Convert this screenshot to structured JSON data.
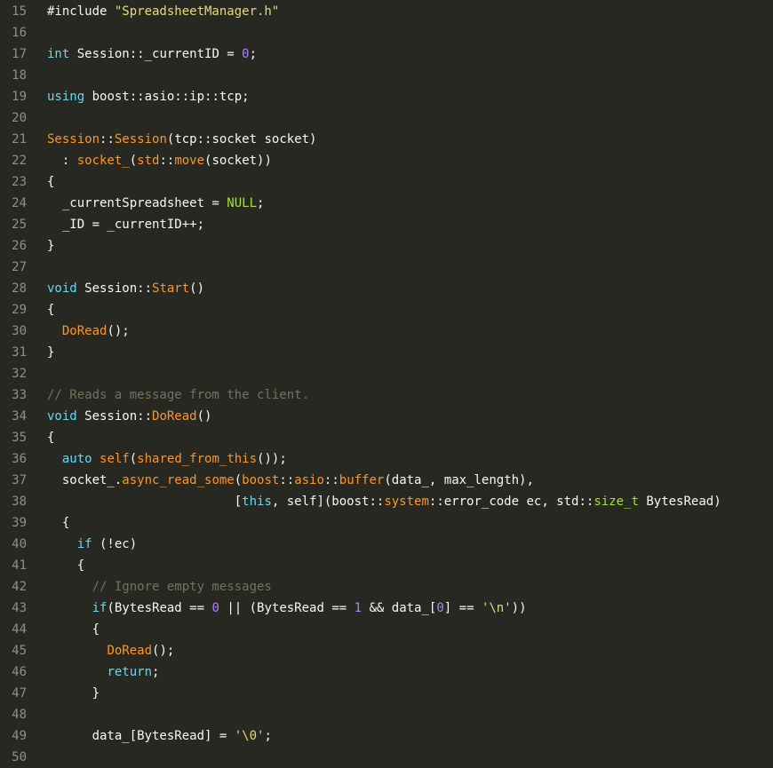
{
  "colors": {
    "background": "#272822",
    "gutter_text": "#8f908a",
    "default_text": "#f8f8f2",
    "keyword": "#66d9ef",
    "string": "#e6db74",
    "number": "#ae81ff",
    "function": "#fd971f",
    "namespace": "#f92672",
    "type": "#a6e22e",
    "comment": "#75715e",
    "literal": "#a6e22e"
  },
  "editor": {
    "lines": [
      {
        "num": "15",
        "tokens": [
          {
            "t": "#include ",
            "c": "default"
          },
          {
            "t": "\"SpreadsheetManager.h\"",
            "c": "string"
          }
        ]
      },
      {
        "num": "16",
        "tokens": []
      },
      {
        "num": "17",
        "tokens": [
          {
            "t": "int",
            "c": "keyword"
          },
          {
            "t": " Session::_currentID = ",
            "c": "default"
          },
          {
            "t": "0",
            "c": "number"
          },
          {
            "t": ";",
            "c": "default"
          }
        ]
      },
      {
        "num": "18",
        "tokens": []
      },
      {
        "num": "19",
        "tokens": [
          {
            "t": "using",
            "c": "keyword"
          },
          {
            "t": " boost::asio::ip::tcp;",
            "c": "default"
          }
        ]
      },
      {
        "num": "20",
        "tokens": []
      },
      {
        "num": "21",
        "tokens": [
          {
            "t": "Session",
            "c": "function"
          },
          {
            "t": "::",
            "c": "default"
          },
          {
            "t": "Session",
            "c": "function"
          },
          {
            "t": "(tcp::socket socket)",
            "c": "default"
          }
        ]
      },
      {
        "num": "22",
        "tokens": [
          {
            "t": "  : ",
            "c": "default"
          },
          {
            "t": "socket_",
            "c": "function"
          },
          {
            "t": "(",
            "c": "default"
          },
          {
            "t": "std",
            "c": "function"
          },
          {
            "t": "::",
            "c": "default"
          },
          {
            "t": "move",
            "c": "function"
          },
          {
            "t": "(socket))",
            "c": "default"
          }
        ]
      },
      {
        "num": "23",
        "tokens": [
          {
            "t": "{",
            "c": "default"
          }
        ]
      },
      {
        "num": "24",
        "tokens": [
          {
            "t": "  _currentSpreadsheet = ",
            "c": "default"
          },
          {
            "t": "NULL",
            "c": "literal"
          },
          {
            "t": ";",
            "c": "default"
          }
        ]
      },
      {
        "num": "25",
        "tokens": [
          {
            "t": "  _ID = _currentID++;",
            "c": "default"
          }
        ]
      },
      {
        "num": "26",
        "tokens": [
          {
            "t": "}",
            "c": "default"
          }
        ]
      },
      {
        "num": "27",
        "tokens": []
      },
      {
        "num": "28",
        "tokens": [
          {
            "t": "void",
            "c": "keyword"
          },
          {
            "t": " Session::",
            "c": "default"
          },
          {
            "t": "Start",
            "c": "function"
          },
          {
            "t": "()",
            "c": "default"
          }
        ]
      },
      {
        "num": "29",
        "tokens": [
          {
            "t": "{",
            "c": "default"
          }
        ]
      },
      {
        "num": "30",
        "tokens": [
          {
            "t": "  ",
            "c": "default"
          },
          {
            "t": "DoRead",
            "c": "function"
          },
          {
            "t": "();",
            "c": "default"
          }
        ]
      },
      {
        "num": "31",
        "tokens": [
          {
            "t": "}",
            "c": "default"
          }
        ]
      },
      {
        "num": "32",
        "tokens": []
      },
      {
        "num": "33",
        "tokens": [
          {
            "t": "// Reads a message from the client.",
            "c": "comment"
          }
        ]
      },
      {
        "num": "34",
        "tokens": [
          {
            "t": "void",
            "c": "keyword"
          },
          {
            "t": " Session::",
            "c": "default"
          },
          {
            "t": "DoRead",
            "c": "function"
          },
          {
            "t": "()",
            "c": "default"
          }
        ]
      },
      {
        "num": "35",
        "tokens": [
          {
            "t": "{",
            "c": "default"
          }
        ]
      },
      {
        "num": "36",
        "tokens": [
          {
            "t": "  ",
            "c": "default"
          },
          {
            "t": "auto",
            "c": "keyword"
          },
          {
            "t": " ",
            "c": "default"
          },
          {
            "t": "self",
            "c": "function"
          },
          {
            "t": "(",
            "c": "default"
          },
          {
            "t": "shared_from_this",
            "c": "function"
          },
          {
            "t": "());",
            "c": "default"
          }
        ]
      },
      {
        "num": "37",
        "tokens": [
          {
            "t": "  socket_.",
            "c": "default"
          },
          {
            "t": "async_read_some",
            "c": "function"
          },
          {
            "t": "(",
            "c": "default"
          },
          {
            "t": "boost",
            "c": "function"
          },
          {
            "t": "::",
            "c": "default"
          },
          {
            "t": "asio",
            "c": "function"
          },
          {
            "t": "::",
            "c": "default"
          },
          {
            "t": "buffer",
            "c": "function"
          },
          {
            "t": "(data_, max_length),",
            "c": "default"
          }
        ]
      },
      {
        "num": "38",
        "tokens": [
          {
            "t": "                         [",
            "c": "default"
          },
          {
            "t": "this",
            "c": "keyword"
          },
          {
            "t": ", self](boost::",
            "c": "default"
          },
          {
            "t": "system",
            "c": "function"
          },
          {
            "t": "::error_code ec, std::",
            "c": "default"
          },
          {
            "t": "size_t",
            "c": "type"
          },
          {
            "t": " BytesRead)",
            "c": "default"
          }
        ]
      },
      {
        "num": "39",
        "tokens": [
          {
            "t": "  {",
            "c": "default"
          }
        ]
      },
      {
        "num": "40",
        "tokens": [
          {
            "t": "    ",
            "c": "default"
          },
          {
            "t": "if",
            "c": "keyword"
          },
          {
            "t": " (!ec)",
            "c": "default"
          }
        ]
      },
      {
        "num": "41",
        "tokens": [
          {
            "t": "    {",
            "c": "default"
          }
        ]
      },
      {
        "num": "42",
        "tokens": [
          {
            "t": "      // Ignore empty messages",
            "c": "comment"
          }
        ]
      },
      {
        "num": "43",
        "tokens": [
          {
            "t": "      ",
            "c": "default"
          },
          {
            "t": "if",
            "c": "keyword"
          },
          {
            "t": "(BytesRead == ",
            "c": "default"
          },
          {
            "t": "0",
            "c": "number"
          },
          {
            "t": " || (BytesRead == ",
            "c": "default"
          },
          {
            "t": "1",
            "c": "number"
          },
          {
            "t": " && data_[",
            "c": "default"
          },
          {
            "t": "0",
            "c": "number"
          },
          {
            "t": "] == ",
            "c": "default"
          },
          {
            "t": "'\\n'",
            "c": "string"
          },
          {
            "t": "))",
            "c": "default"
          }
        ]
      },
      {
        "num": "44",
        "tokens": [
          {
            "t": "      {",
            "c": "default"
          }
        ]
      },
      {
        "num": "45",
        "tokens": [
          {
            "t": "        ",
            "c": "default"
          },
          {
            "t": "DoRead",
            "c": "function"
          },
          {
            "t": "();",
            "c": "default"
          }
        ]
      },
      {
        "num": "46",
        "tokens": [
          {
            "t": "        ",
            "c": "default"
          },
          {
            "t": "return",
            "c": "keyword"
          },
          {
            "t": ";",
            "c": "default"
          }
        ]
      },
      {
        "num": "47",
        "tokens": [
          {
            "t": "      }",
            "c": "default"
          }
        ]
      },
      {
        "num": "48",
        "tokens": []
      },
      {
        "num": "49",
        "tokens": [
          {
            "t": "      data_[BytesRead] = ",
            "c": "default"
          },
          {
            "t": "'\\0'",
            "c": "string"
          },
          {
            "t": ";",
            "c": "default"
          }
        ]
      },
      {
        "num": "50",
        "tokens": []
      }
    ]
  }
}
